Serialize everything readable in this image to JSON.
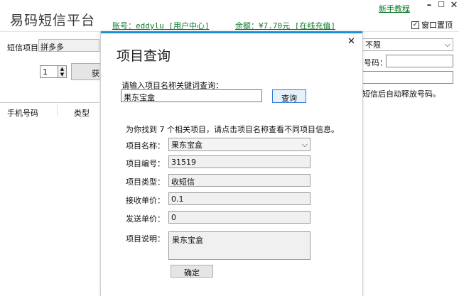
{
  "header": {
    "title": "易码短信平台",
    "account": "账号：eddylu [用户中心]",
    "balance": "余额：¥7.70元 [在线充值]",
    "tutorial": "新手教程",
    "pin_label": "窗口置顶",
    "pin_checked": true
  },
  "toolbar": {
    "sms_project_label": "短信项目：",
    "sms_project_value": "拼多多",
    "quantity": "1",
    "get_button_label": "获",
    "filter_value": "不限",
    "number_label": "号码：",
    "release_hint": "短信后自动释放号码。"
  },
  "table": {
    "columns": [
      "手机号码",
      "类型"
    ]
  },
  "dialog": {
    "title": "项目查询",
    "search_prompt": "请输入项目名称关键词查询：",
    "search_value": "果东宝盒",
    "search_button": "查询",
    "result_summary": "为你找到 7 个相关项目，请点击项目名称查看不同项目信息。",
    "fields": {
      "name_label": "项目名称：",
      "name_value": "果东宝盒",
      "id_label": "项目编号：",
      "id_value": "31519",
      "type_label": "项目类型：",
      "type_value": "收短信",
      "recv_price_label": "接收单价：",
      "recv_price_value": "0.1",
      "send_price_label": "发送单价：",
      "send_price_value": "0",
      "desc_label": "项目说明：",
      "desc_value": "果东宝盒"
    },
    "confirm_button": "确定"
  },
  "colors": {
    "link": "#0a7a2a",
    "accent": "#1e90d8"
  }
}
